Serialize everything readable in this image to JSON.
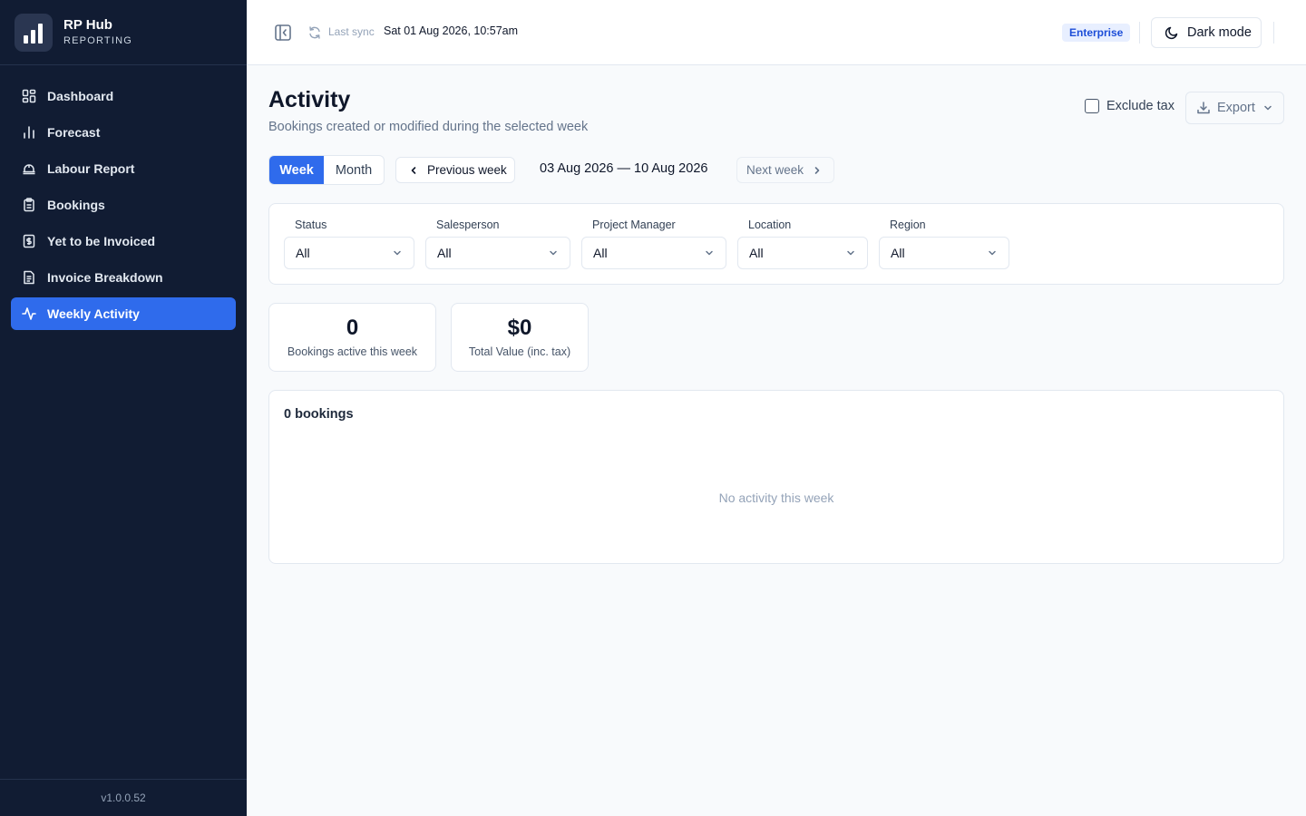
{
  "app": {
    "name": "RP Hub",
    "subtitle": "REPORTING",
    "version": "v1.0.0.52"
  },
  "sidebar": {
    "items": [
      {
        "label": "Dashboard",
        "icon": "dashboard-grid-icon",
        "active": false
      },
      {
        "label": "Forecast",
        "icon": "bar-chart-icon",
        "active": false
      },
      {
        "label": "Labour Report",
        "icon": "hard-hat-icon",
        "active": false
      },
      {
        "label": "Bookings",
        "icon": "clipboard-icon",
        "active": false
      },
      {
        "label": "Yet to be Invoiced",
        "icon": "dollar-document-icon",
        "active": false
      },
      {
        "label": "Invoice Breakdown",
        "icon": "document-icon",
        "active": false
      },
      {
        "label": "Weekly Activity",
        "icon": "activity-pulse-icon",
        "active": true
      }
    ]
  },
  "header": {
    "sync_label": "Last sync",
    "sync_value": "Sat 01 Aug 2026, 10:57am",
    "plan_badge": "Enterprise",
    "dark_mode_label": "Dark mode"
  },
  "page": {
    "title": "Activity",
    "subtitle": "Bookings created or modified during the selected week",
    "exclude_tax_label": "Exclude tax",
    "exclude_tax_checked": false,
    "export_label": "Export"
  },
  "period": {
    "week_label": "Week",
    "month_label": "Month",
    "selected": "Week",
    "previous_label": "Previous week",
    "range": "03 Aug 2026 — 10 Aug 2026",
    "next_label": "Next week"
  },
  "filters": [
    {
      "label": "Status",
      "value": "All"
    },
    {
      "label": "Salesperson",
      "value": "All"
    },
    {
      "label": "Project Manager",
      "value": "All"
    },
    {
      "label": "Location",
      "value": "All"
    },
    {
      "label": "Region",
      "value": "All"
    }
  ],
  "stats": [
    {
      "value": "0",
      "label": "Bookings active this week"
    },
    {
      "value": "$0",
      "label": "Total Value (inc. tax)"
    }
  ],
  "bookings": {
    "title": "0 bookings",
    "empty_message": "No activity this week"
  },
  "colors": {
    "sidebar_bg": "#111c33",
    "accent": "#2f6bec",
    "badge_bg": "#e8efff",
    "badge_text": "#1d4ed8"
  }
}
